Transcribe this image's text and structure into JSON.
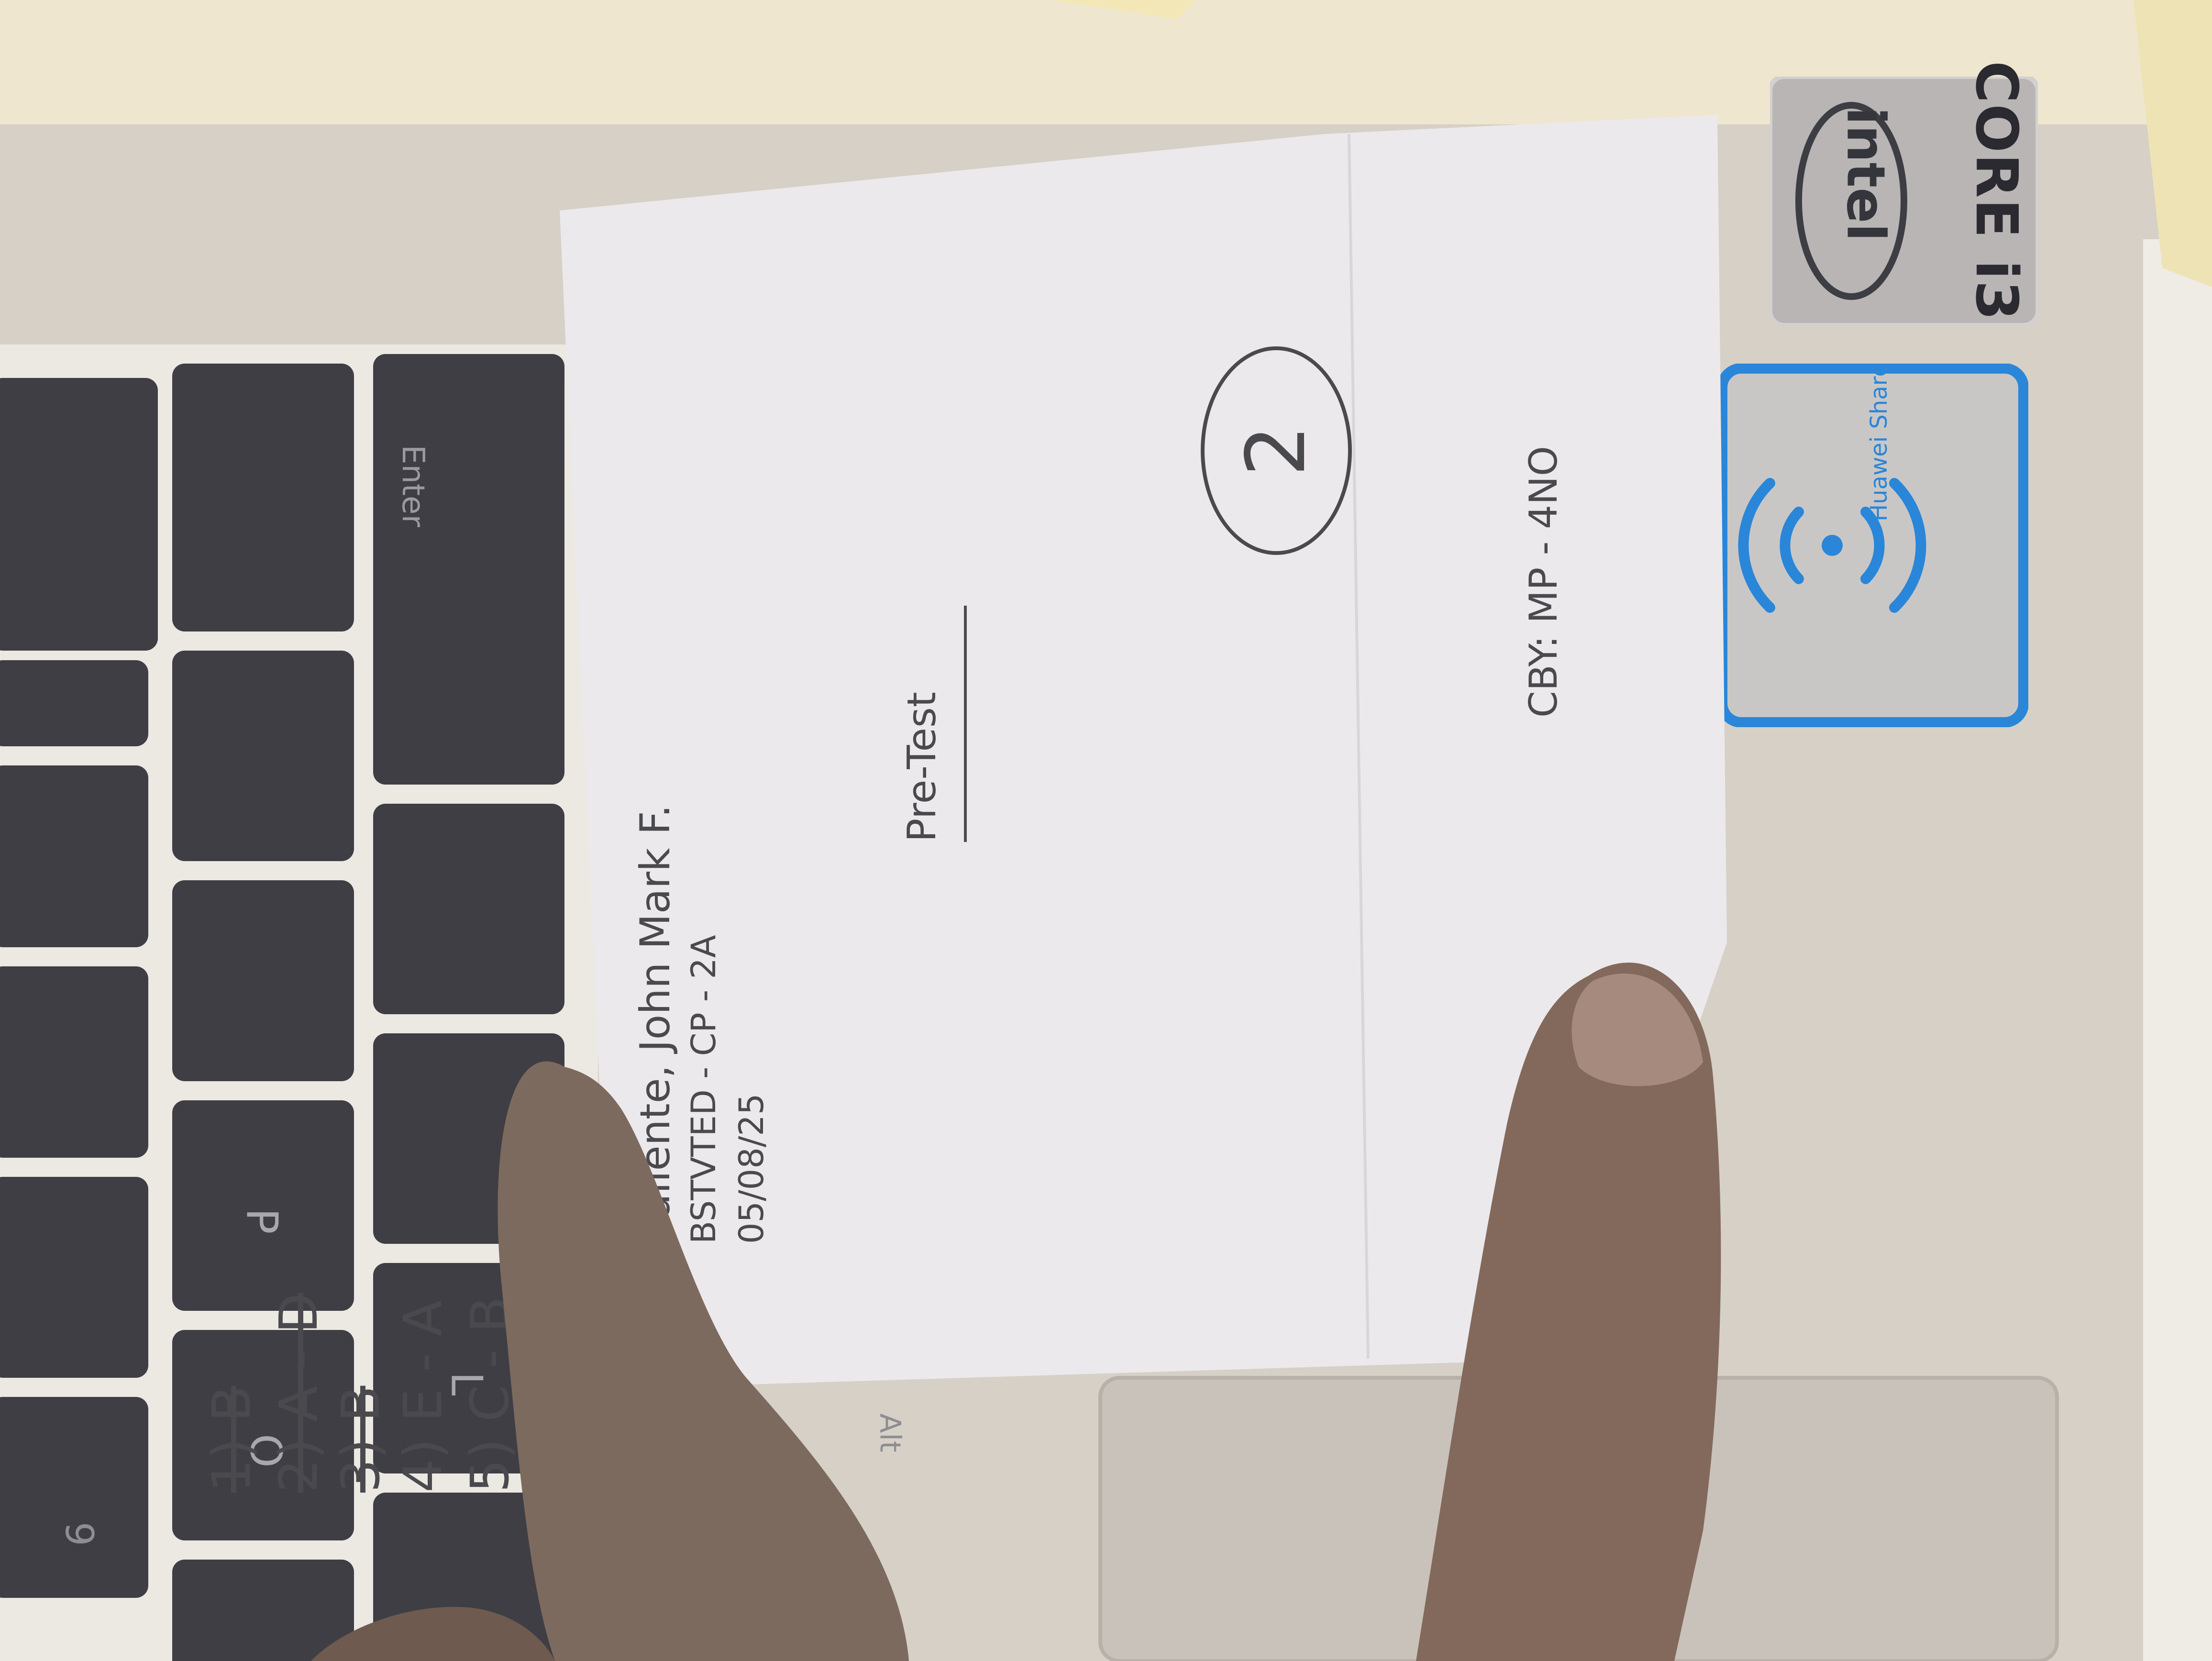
{
  "keyboard": {
    "keys": [
      {
        "id": "backspace",
        "label": "⌫"
      },
      {
        "id": "backslash",
        "label": "| \\"
      },
      {
        "id": "enter",
        "label": "Enter"
      },
      {
        "id": "plus",
        "label": "+ ="
      },
      {
        "id": "brace-close",
        "label": "} ]"
      },
      {
        "id": "quote",
        "label": "\" '"
      },
      {
        "id": "minus",
        "label": "— -"
      },
      {
        "id": "brace-open",
        "label": "{ ["
      },
      {
        "id": "p",
        "label": "P"
      },
      {
        "id": "o",
        "label": "O"
      },
      {
        "id": "l",
        "label": "L"
      },
      {
        "id": "i",
        "label": "9"
      },
      {
        "id": "alt",
        "label": "Alt"
      }
    ]
  },
  "stickers": {
    "intel_brand": "intel",
    "intel_model": "CORE i3",
    "share_label": "Huawei Share"
  },
  "paper": {
    "name_line": "Valiente, John Mark F.",
    "section_line": "BSTVTED - CP - 2A",
    "date_line": "05/08/25",
    "score": "2",
    "title": "Pre-Test",
    "answers": [
      {
        "text": "1) B",
        "crossed": true
      },
      {
        "text": "2) A - D",
        "crossed": true
      },
      {
        "text": "3) B",
        "crossed": true
      },
      {
        "text": "4) E - A",
        "crossed": false
      },
      {
        "text": "5) C - B",
        "crossed": false
      }
    ],
    "checked_by": "CBY: MP - 4NO"
  },
  "colors": {
    "laptop_body": "#d8d2c8",
    "key": "#3e3e44",
    "paper": "#ece9ec",
    "ink": "#4a4a4e",
    "share_blue": "#2a86d8",
    "skin": "#7d6a5e"
  }
}
